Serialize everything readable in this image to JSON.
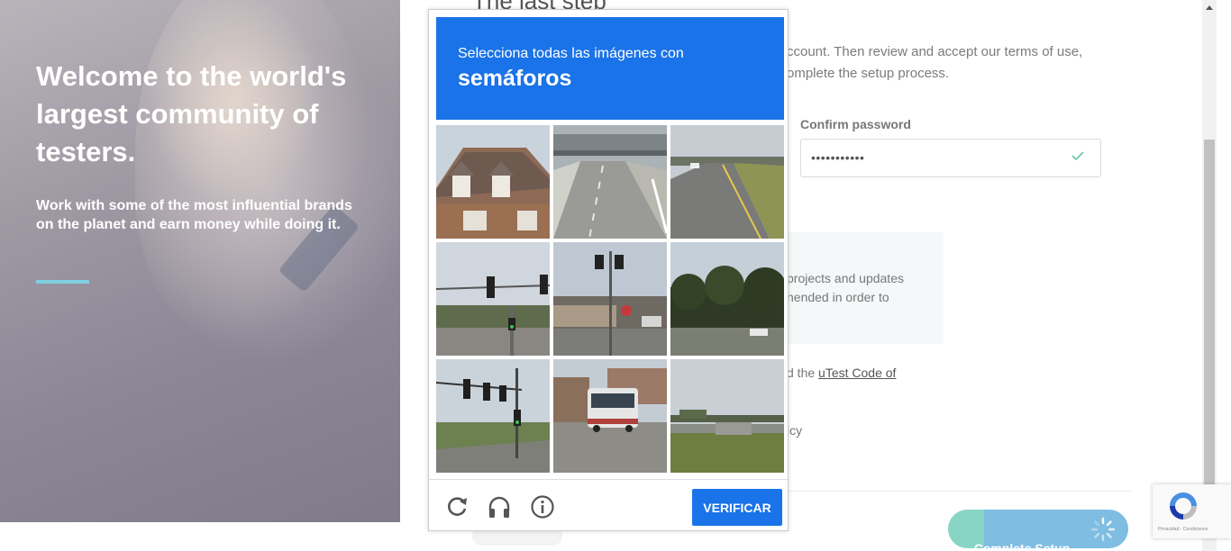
{
  "hero": {
    "heading": "Welcome to the world's largest community of testers.",
    "subheading": "Work with some of the most influential brands on the planet and earn money while doing it."
  },
  "form": {
    "title": "The last step",
    "intro_line1": "ccount. Then review and accept our terms of use,",
    "intro_line2": "omplete the setup process.",
    "confirm_password_label": "Confirm password",
    "confirm_password_value": "•••••••••••",
    "info_line1": "projects and updates",
    "info_line2": "nended in order to",
    "agree_prefix": "d the ",
    "code_link": "uTest Code of",
    "policy_fragment": "icy",
    "complete_button": "Complete Setup"
  },
  "captcha": {
    "instruction": "Selecciona todas las imágenes con",
    "target": "semáforos",
    "verify_button": "VERIFICAR",
    "tiles": [
      {
        "scene": "house"
      },
      {
        "scene": "highway-overpass"
      },
      {
        "scene": "highway-field"
      },
      {
        "scene": "traffic-light-street"
      },
      {
        "scene": "traffic-light-intersection"
      },
      {
        "scene": "trees-road"
      },
      {
        "scene": "traffic-light-road"
      },
      {
        "scene": "bus-street"
      },
      {
        "scene": "bridge-field"
      }
    ]
  },
  "recaptcha_badge": {
    "terms": "Privacidad - Condiciones"
  },
  "colors": {
    "captcha_blue": "#1a73e8",
    "accent_line": "#80cfe0",
    "complete_button": "#7fbde2"
  },
  "icons": [
    "reload-icon",
    "headphones-icon",
    "info-icon",
    "checkmark-icon",
    "spinner-icon",
    "recaptcha-logo"
  ]
}
